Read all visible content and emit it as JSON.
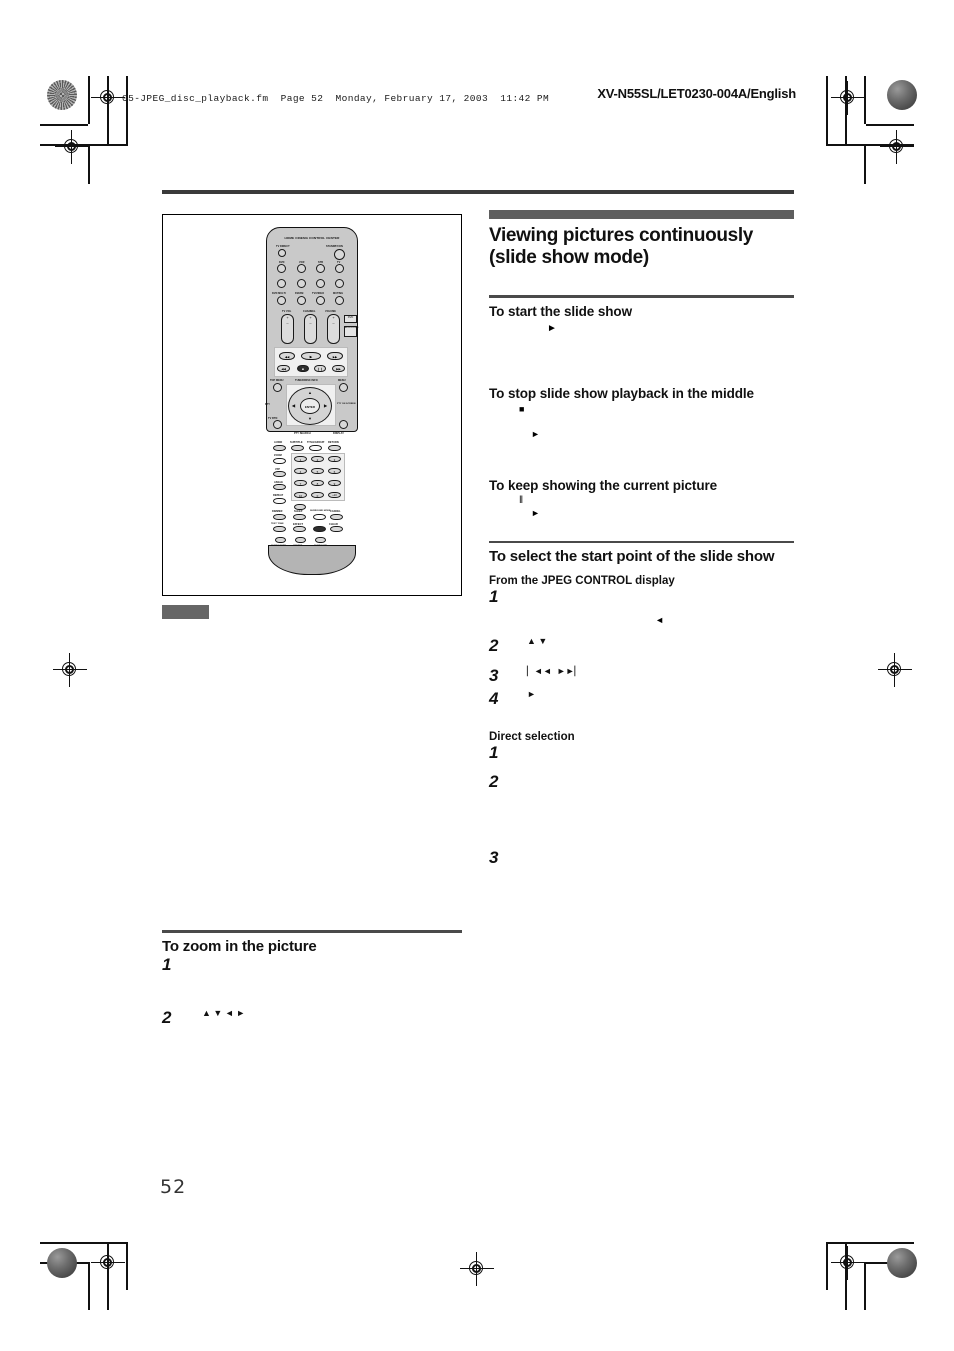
{
  "header": {
    "file_info": "05-JPEG_disc_playback.fm  Page 52  Monday, February 17, 2003  11:42 PM",
    "doc_code": "XV-N55SL/LET0230-004A/English"
  },
  "page": {
    "number": "52"
  },
  "figure": {
    "caption_marker": "",
    "remote": {
      "title": "HOME CINEMA CONTROL CENTER",
      "labels": {
        "tv_direct": "TV DIRECT",
        "standby_on": "STANDBY/ON",
        "dvd": "DVD",
        "vcr": "VCR",
        "stb": "STB",
        "tv": "TV",
        "dvd_multi": "DVD MULTI",
        "fm_am": "FM/AM",
        "tv_video": "TV/VIDEO",
        "muting": "MUTING",
        "tv_vol": "TV VOL",
        "channel": "CHANNEL",
        "volume": "VOLUME",
        "top_menu": "TOP MENU",
        "menu": "MENU",
        "enter": "ENTER",
        "pty": "PTY",
        "pty_on_screen": "PTY ON SCREEN",
        "tv_rtn": "TV RTN",
        "display": "DISPLAY",
        "pty_search": "PTY SEARCH",
        "tuner_disc_info": "TUNER/DISC INFO",
        "audio": "AUDIO",
        "subtitle": "SUBTITLE",
        "title_group": "TITLE/GROUP",
        "return": "RETURN",
        "zoom": "ZOOM",
        "vfp": "VFP",
        "angle": "ANGLE",
        "repeat": "REPEAT",
        "dimmer": "DIMMER",
        "sleep": "SLEEP",
        "surround_mode": "SURROUND MODE",
        "cancel": "CANCEL",
        "test_tone": "TEST TONE",
        "effect": "EFFECT",
        "one_touch_play": "ONE TOUCH PLAY",
        "clear": "CLEAR",
        "bass_boost": "BASS BOOST",
        "subwoofer": "SUBWOOFER",
        "center": "CENTER",
        "surround": "SURROUND",
        "dvd_side": "DVD",
        "audio_video": "AUDIO/VIDEO",
        "keys_numeric": [
          "1",
          "2",
          "3",
          "4",
          "5",
          "6",
          "7",
          "8",
          "9",
          "10",
          "0",
          "+10"
        ]
      }
    }
  },
  "left_column": {
    "zoom_section": {
      "heading": "To zoom in the picture",
      "steps": [
        {
          "num": "1",
          "text": ""
        },
        {
          "num": "2",
          "text": "▲ ▼ ◄ ►"
        }
      ]
    }
  },
  "right_column": {
    "section_title": "Viewing pictures continuously (slide show mode)",
    "start_slide_show": {
      "heading": "To start the slide show",
      "glyph": "►"
    },
    "stop_slide_show": {
      "heading": "To stop slide show playback in the middle",
      "glyph_1": "■",
      "glyph_2": "►"
    },
    "keep_current_picture": {
      "heading": "To keep showing the current picture",
      "glyph_1": "‖",
      "glyph_2": "►"
    },
    "select_start_point": {
      "heading": "To select the start point of the slide show",
      "from_jpeg_control": {
        "label": "From the JPEG CONTROL display",
        "steps": [
          {
            "num": "1",
            "text": "",
            "trailing_glyph": "◄"
          },
          {
            "num": "2",
            "text": "▲ ▼"
          },
          {
            "num": "3",
            "text": "▏◄◄  ►►▏"
          },
          {
            "num": "4",
            "text": "►"
          }
        ]
      },
      "direct_selection": {
        "label": "Direct selection",
        "steps": [
          {
            "num": "1",
            "text": ""
          },
          {
            "num": "2",
            "text": ""
          },
          {
            "num": "3",
            "text": ""
          }
        ]
      }
    }
  }
}
